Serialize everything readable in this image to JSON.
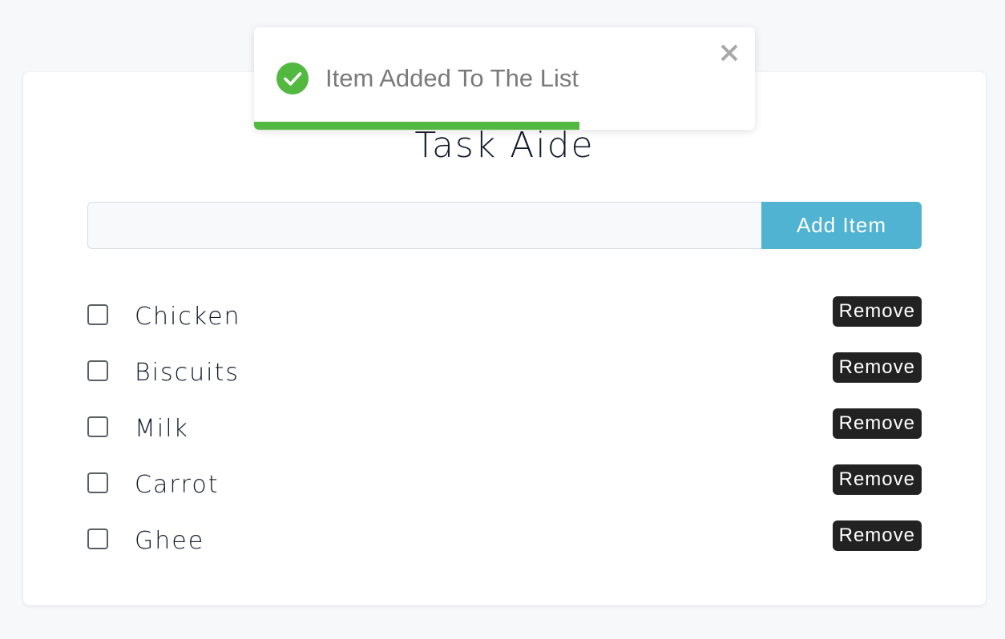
{
  "app": {
    "title": "Task Aide"
  },
  "add_form": {
    "input_value": "",
    "input_placeholder": "",
    "button_label": "Add Item"
  },
  "tasks": [
    {
      "label": "Chicken",
      "checked": false,
      "remove_label": "Remove"
    },
    {
      "label": "Biscuits",
      "checked": false,
      "remove_label": "Remove"
    },
    {
      "label": "Milk",
      "checked": false,
      "remove_label": "Remove"
    },
    {
      "label": "Carrot",
      "checked": false,
      "remove_label": "Remove"
    },
    {
      "label": "Ghee",
      "checked": false,
      "remove_label": "Remove"
    }
  ],
  "toast": {
    "message": "Item Added To The List",
    "status_icon": "check-circle-icon",
    "close_icon": "close-icon",
    "progress_fraction": 0.65,
    "color": "#52b840"
  },
  "colors": {
    "accent": "#4fb3d1",
    "remove_button": "#222222",
    "success": "#52b840",
    "background": "#f7f8fa"
  }
}
